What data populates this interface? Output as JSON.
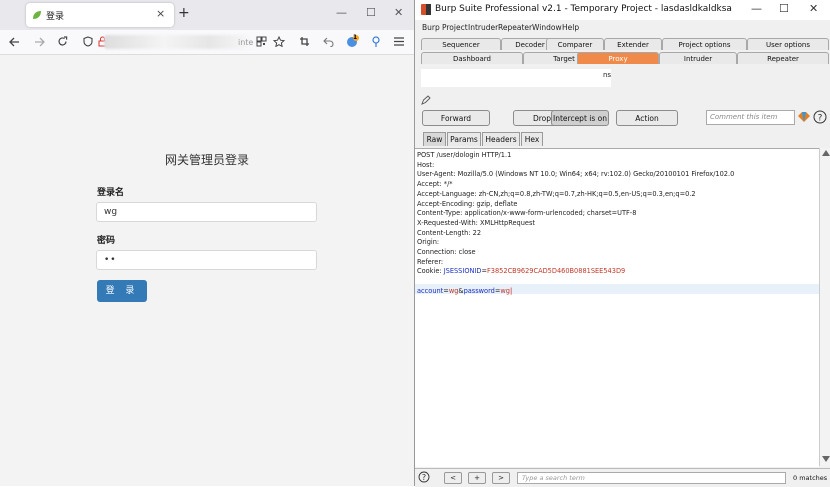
{
  "browser": {
    "tab_title": "登录",
    "tab_close": "×",
    "new_tab": "+",
    "win_min": "—",
    "win_max": "☐",
    "win_close": "✕",
    "url_fragment": "inte",
    "extension_badge": "1"
  },
  "login": {
    "title": "网关管理员登录",
    "username_label": "登录名",
    "username_value": "wg",
    "password_label": "密码",
    "password_value": "••",
    "submit_label": "登 录",
    "button_color": "#337ab7"
  },
  "burp": {
    "window_title": "Burp Suite Professional v2.1 - Temporary Project - lasdasldkaldksa",
    "menu": [
      "Burp",
      "Project",
      "Intruder",
      "Repeater",
      "Window",
      "Help"
    ],
    "tabs_row1": [
      "Sequencer",
      "Decoder",
      "Comparer",
      "Extender",
      "Project options",
      "User options"
    ],
    "tabs_row2": [
      "Dashboard",
      "Target",
      "Proxy",
      "Intruder",
      "Repeater"
    ],
    "active_tab": "Proxy",
    "accent_color": "#f08a4b",
    "subtab_fragment": "ns",
    "buttons": {
      "forward": "Forward",
      "drop": "Drop",
      "intercept": "Intercept is on",
      "action": "Action"
    },
    "comment_placeholder": "Comment this item",
    "view_tabs": [
      "Raw",
      "Params",
      "Headers",
      "Hex"
    ],
    "request_lines": [
      "POST /user/dologin HTTP/1.1",
      "Host:",
      "User-Agent: Mozilla/5.0 (Windows NT 10.0; Win64; x64; rv:102.0) Gecko/20100101 Firefox/102.0",
      "Accept: */*",
      "Accept-Language: zh-CN,zh;q=0.8,zh-TW;q=0.7,zh-HK;q=0.5,en-US;q=0.3,en;q=0.2",
      "Accept-Encoding: gzip, deflate",
      "Content-Type: application/x-www-form-urlencoded; charset=UTF-8",
      "X-Requested-With: XMLHttpRequest",
      "Content-Length: 22",
      "Origin:",
      "Connection: close",
      "Referer:"
    ],
    "cookie_prefix": "Cookie: ",
    "cookie_key": "JSESSIONID",
    "cookie_eq": "=",
    "cookie_value": "F3852CB9629CAD5D460B0881SEE543D9",
    "body": {
      "k1": "account",
      "v1": "wg",
      "k2": "password",
      "v2": "wg"
    },
    "bottom": {
      "help": "?",
      "prev": "<",
      "add": "+",
      "next": ">",
      "search_placeholder": "Type a search term",
      "matches": "0 matches"
    }
  }
}
